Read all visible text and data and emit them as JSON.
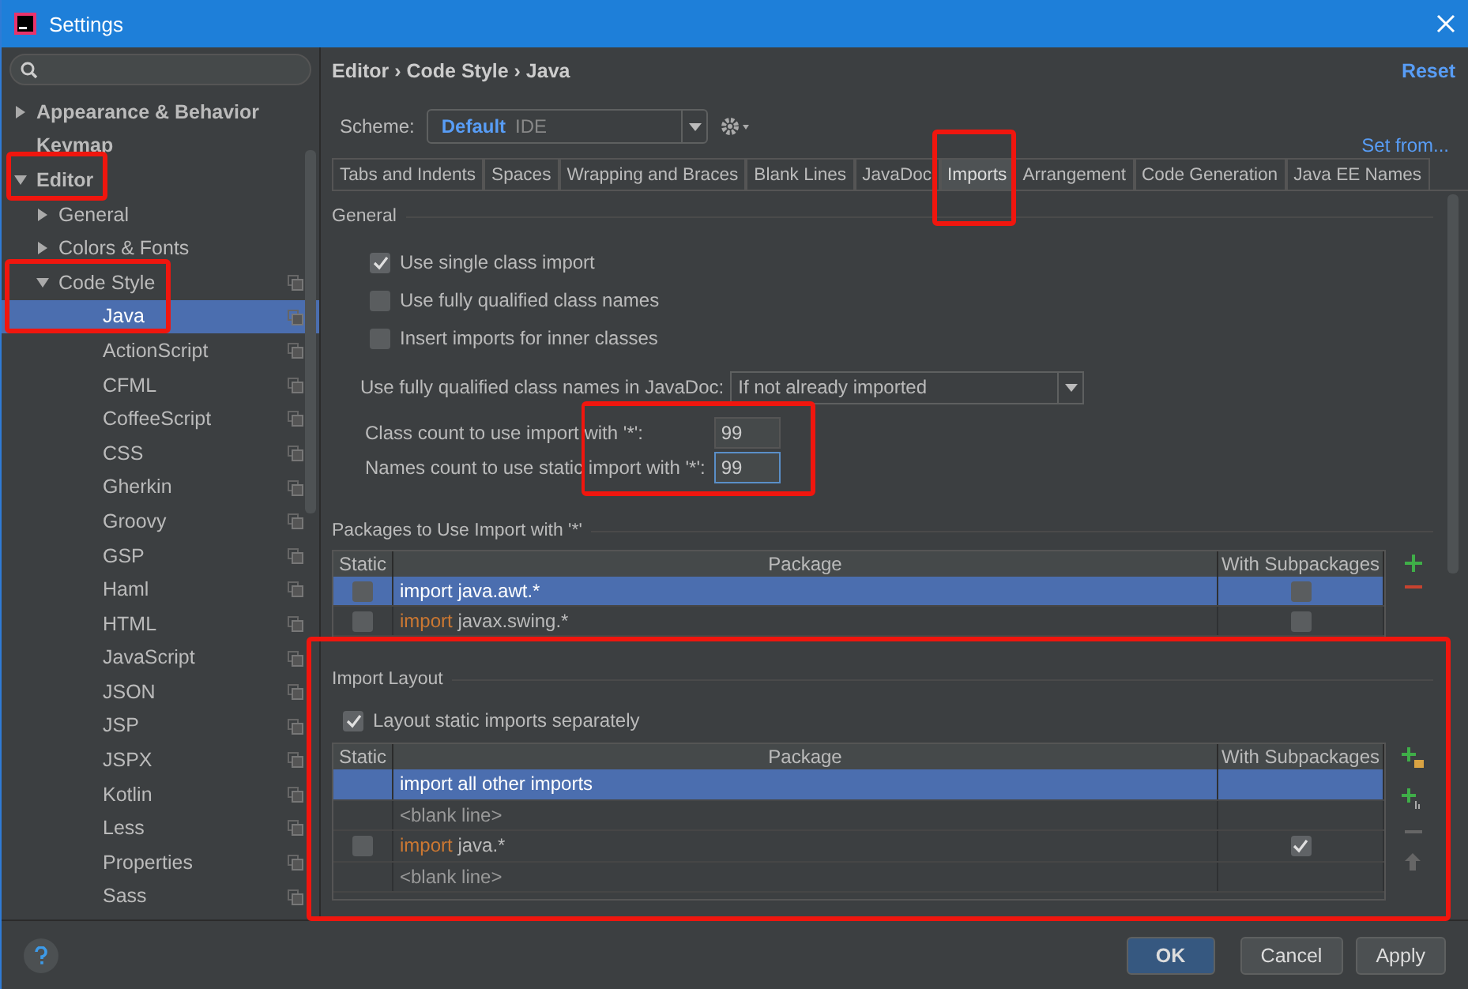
{
  "window": {
    "title": "Settings"
  },
  "sidebar": {
    "items": [
      {
        "label": "Appearance & Behavior",
        "bold": true,
        "expanded": false,
        "selected": false
      },
      {
        "label": "Keymap",
        "bold": true,
        "selected": false
      },
      {
        "label": "Editor",
        "bold": true,
        "expanded": true,
        "selected": false,
        "children": [
          {
            "label": "General",
            "expanded": false,
            "selected": false
          },
          {
            "label": "Colors & Fonts",
            "expanded": false,
            "selected": false
          },
          {
            "label": "Code Style",
            "expanded": true,
            "selected": false,
            "scheme_specific": true,
            "children": [
              {
                "label": "Java",
                "selected": true,
                "scheme_specific": true
              },
              {
                "label": "ActionScript",
                "selected": false,
                "scheme_specific": true
              },
              {
                "label": "CFML",
                "selected": false,
                "scheme_specific": true
              },
              {
                "label": "CoffeeScript",
                "selected": false,
                "scheme_specific": true
              },
              {
                "label": "CSS",
                "selected": false,
                "scheme_specific": true
              },
              {
                "label": "Gherkin",
                "selected": false,
                "scheme_specific": true
              },
              {
                "label": "Groovy",
                "selected": false,
                "scheme_specific": true
              },
              {
                "label": "GSP",
                "selected": false,
                "scheme_specific": true
              },
              {
                "label": "Haml",
                "selected": false,
                "scheme_specific": true
              },
              {
                "label": "HTML",
                "selected": false,
                "scheme_specific": true
              },
              {
                "label": "JavaScript",
                "selected": false,
                "scheme_specific": true
              },
              {
                "label": "JSON",
                "selected": false,
                "scheme_specific": true
              },
              {
                "label": "JSP",
                "selected": false,
                "scheme_specific": true
              },
              {
                "label": "JSPX",
                "selected": false,
                "scheme_specific": true
              },
              {
                "label": "Kotlin",
                "selected": false,
                "scheme_specific": true
              },
              {
                "label": "Less",
                "selected": false,
                "scheme_specific": true
              },
              {
                "label": "Properties",
                "selected": false,
                "scheme_specific": true
              },
              {
                "label": "Sass",
                "selected": false,
                "scheme_specific": true
              }
            ]
          }
        ]
      }
    ]
  },
  "breadcrumb": "Editor › Code Style › Java",
  "reset": "Reset",
  "scheme": {
    "label": "Scheme:",
    "name": "Default",
    "type": "IDE"
  },
  "set_from": "Set from...",
  "tabs": [
    {
      "label": "Tabs and Indents",
      "selected": false
    },
    {
      "label": "Spaces",
      "selected": false
    },
    {
      "label": "Wrapping and Braces",
      "selected": false
    },
    {
      "label": "Blank Lines",
      "selected": false
    },
    {
      "label": "JavaDoc",
      "selected": false
    },
    {
      "label": "Imports",
      "selected": true
    },
    {
      "label": "Arrangement",
      "selected": false
    },
    {
      "label": "Code Generation",
      "selected": false
    },
    {
      "label": "Java EE Names",
      "selected": false
    }
  ],
  "general": {
    "title": "General",
    "checkboxes": [
      {
        "label": "Use single class import",
        "checked": true
      },
      {
        "label": "Use fully qualified class names",
        "checked": false
      },
      {
        "label": "Insert imports for inner classes",
        "checked": false
      }
    ],
    "javadoc": {
      "label": "Use fully qualified class names in JavaDoc:",
      "value": "If not already imported"
    },
    "counts": [
      {
        "label": "Class count to use import with '*':",
        "value": "99",
        "focused": false
      },
      {
        "label": "Names count to use static import with '*':",
        "value": "99",
        "focused": true
      }
    ]
  },
  "packages": {
    "title": "Packages to Use Import with '*'",
    "columns": [
      "Static",
      "Package",
      "With Subpackages"
    ],
    "rows": [
      {
        "static": false,
        "keyword": "import",
        "package": "java.awt.*",
        "subpackages": false,
        "selected": true
      },
      {
        "static": false,
        "keyword": "import",
        "package": "javax.swing.*",
        "subpackages": false,
        "selected": false
      }
    ]
  },
  "import_layout": {
    "title": "Import Layout",
    "separate": {
      "label": "Layout static imports separately",
      "checked": true
    },
    "columns": [
      "Static",
      "Package",
      "With Subpackages"
    ],
    "rows": [
      {
        "kind": "all",
        "text": "import all other imports",
        "selected": true
      },
      {
        "kind": "blank",
        "text": "<blank line>",
        "selected": false
      },
      {
        "kind": "import",
        "keyword": "import",
        "package": "java.*",
        "static": false,
        "subpackages": true,
        "selected": false
      },
      {
        "kind": "blank",
        "text": "<blank line>",
        "selected": false
      }
    ]
  },
  "buttons": [
    {
      "label": "OK",
      "default": true
    },
    {
      "label": "Cancel",
      "default": false
    },
    {
      "label": "Apply",
      "default": false
    }
  ]
}
